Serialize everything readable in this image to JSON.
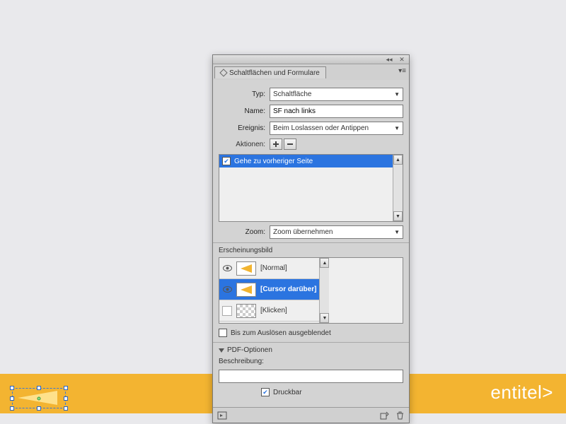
{
  "panel": {
    "tab_title": "Schaltflächen und Formulare",
    "fields": {
      "type_label": "Typ:",
      "type_value": "Schaltfläche",
      "name_label": "Name:",
      "name_value": "SF nach links",
      "event_label": "Ereignis:",
      "event_value": "Beim Loslassen oder Antippen",
      "actions_label": "Aktionen:"
    },
    "actions": [
      {
        "checked": true,
        "label": "Gehe zu vorheriger Seite",
        "selected": true
      }
    ],
    "zoom_label": "Zoom:",
    "zoom_value": "Zoom übernehmen",
    "appearance_label": "Erscheinungsbild",
    "states": [
      {
        "label": "[Normal]",
        "preview": "arrow",
        "visible": true,
        "selected": false
      },
      {
        "label": "[Cursor darüber]",
        "preview": "arrow",
        "visible": true,
        "selected": true
      },
      {
        "label": "[Klicken]",
        "preview": "checker",
        "visible": false,
        "selected": false
      }
    ],
    "hidden_until_label": "Bis zum Auslösen ausgeblendet",
    "hidden_until_checked": false,
    "pdf_section": "PDF-Optionen",
    "description_label": "Beschreibung:",
    "description_value": "",
    "printable_label": "Druckbar",
    "printable_checked": true
  },
  "canvas": {
    "title_fragment": "entitel>"
  }
}
